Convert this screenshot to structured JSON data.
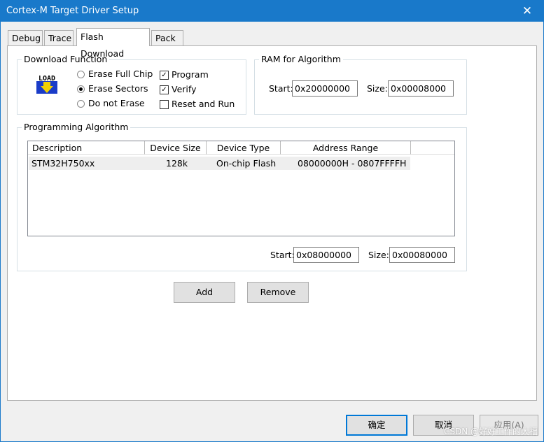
{
  "window": {
    "title": "Cortex-M Target Driver Setup",
    "close_glyph": "✕"
  },
  "tabs": [
    {
      "label": "Debug"
    },
    {
      "label": "Trace"
    },
    {
      "label": "Flash Download"
    },
    {
      "label": "Pack"
    }
  ],
  "download_function": {
    "group_label": "Download Function",
    "icon_text": "LOAD",
    "radios": [
      {
        "label": "Erase Full Chip",
        "selected": false
      },
      {
        "label": "Erase Sectors",
        "selected": true
      },
      {
        "label": "Do not Erase",
        "selected": false
      }
    ],
    "checks": [
      {
        "label": "Program",
        "checked": true
      },
      {
        "label": "Verify",
        "checked": true
      },
      {
        "label": "Reset and Run",
        "checked": false
      }
    ]
  },
  "ram_algorithm": {
    "group_label": "RAM for Algorithm",
    "start_label": "Start:",
    "start_value": "0x20000000",
    "size_label": "Size:",
    "size_value": "0x00008000"
  },
  "programming_algorithm": {
    "group_label": "Programming Algorithm",
    "columns": [
      "Description",
      "Device Size",
      "Device Type",
      "Address Range"
    ],
    "rows": [
      {
        "description": "STM32H750xx",
        "device_size": "128k",
        "device_type": "On-chip Flash",
        "address_range": "08000000H - 0807FFFFH"
      }
    ],
    "start_label": "Start:",
    "start_value": "0x08000000",
    "size_label": "Size:",
    "size_value": "0x00080000"
  },
  "buttons": {
    "add": "Add",
    "remove": "Remove",
    "ok": "确定",
    "cancel": "取消",
    "apply": "应用(A)"
  },
  "watermark": "CSDN @好好工作的大福",
  "colors": {
    "titlebar": "#1979ca",
    "default_border": "#0078d7"
  }
}
